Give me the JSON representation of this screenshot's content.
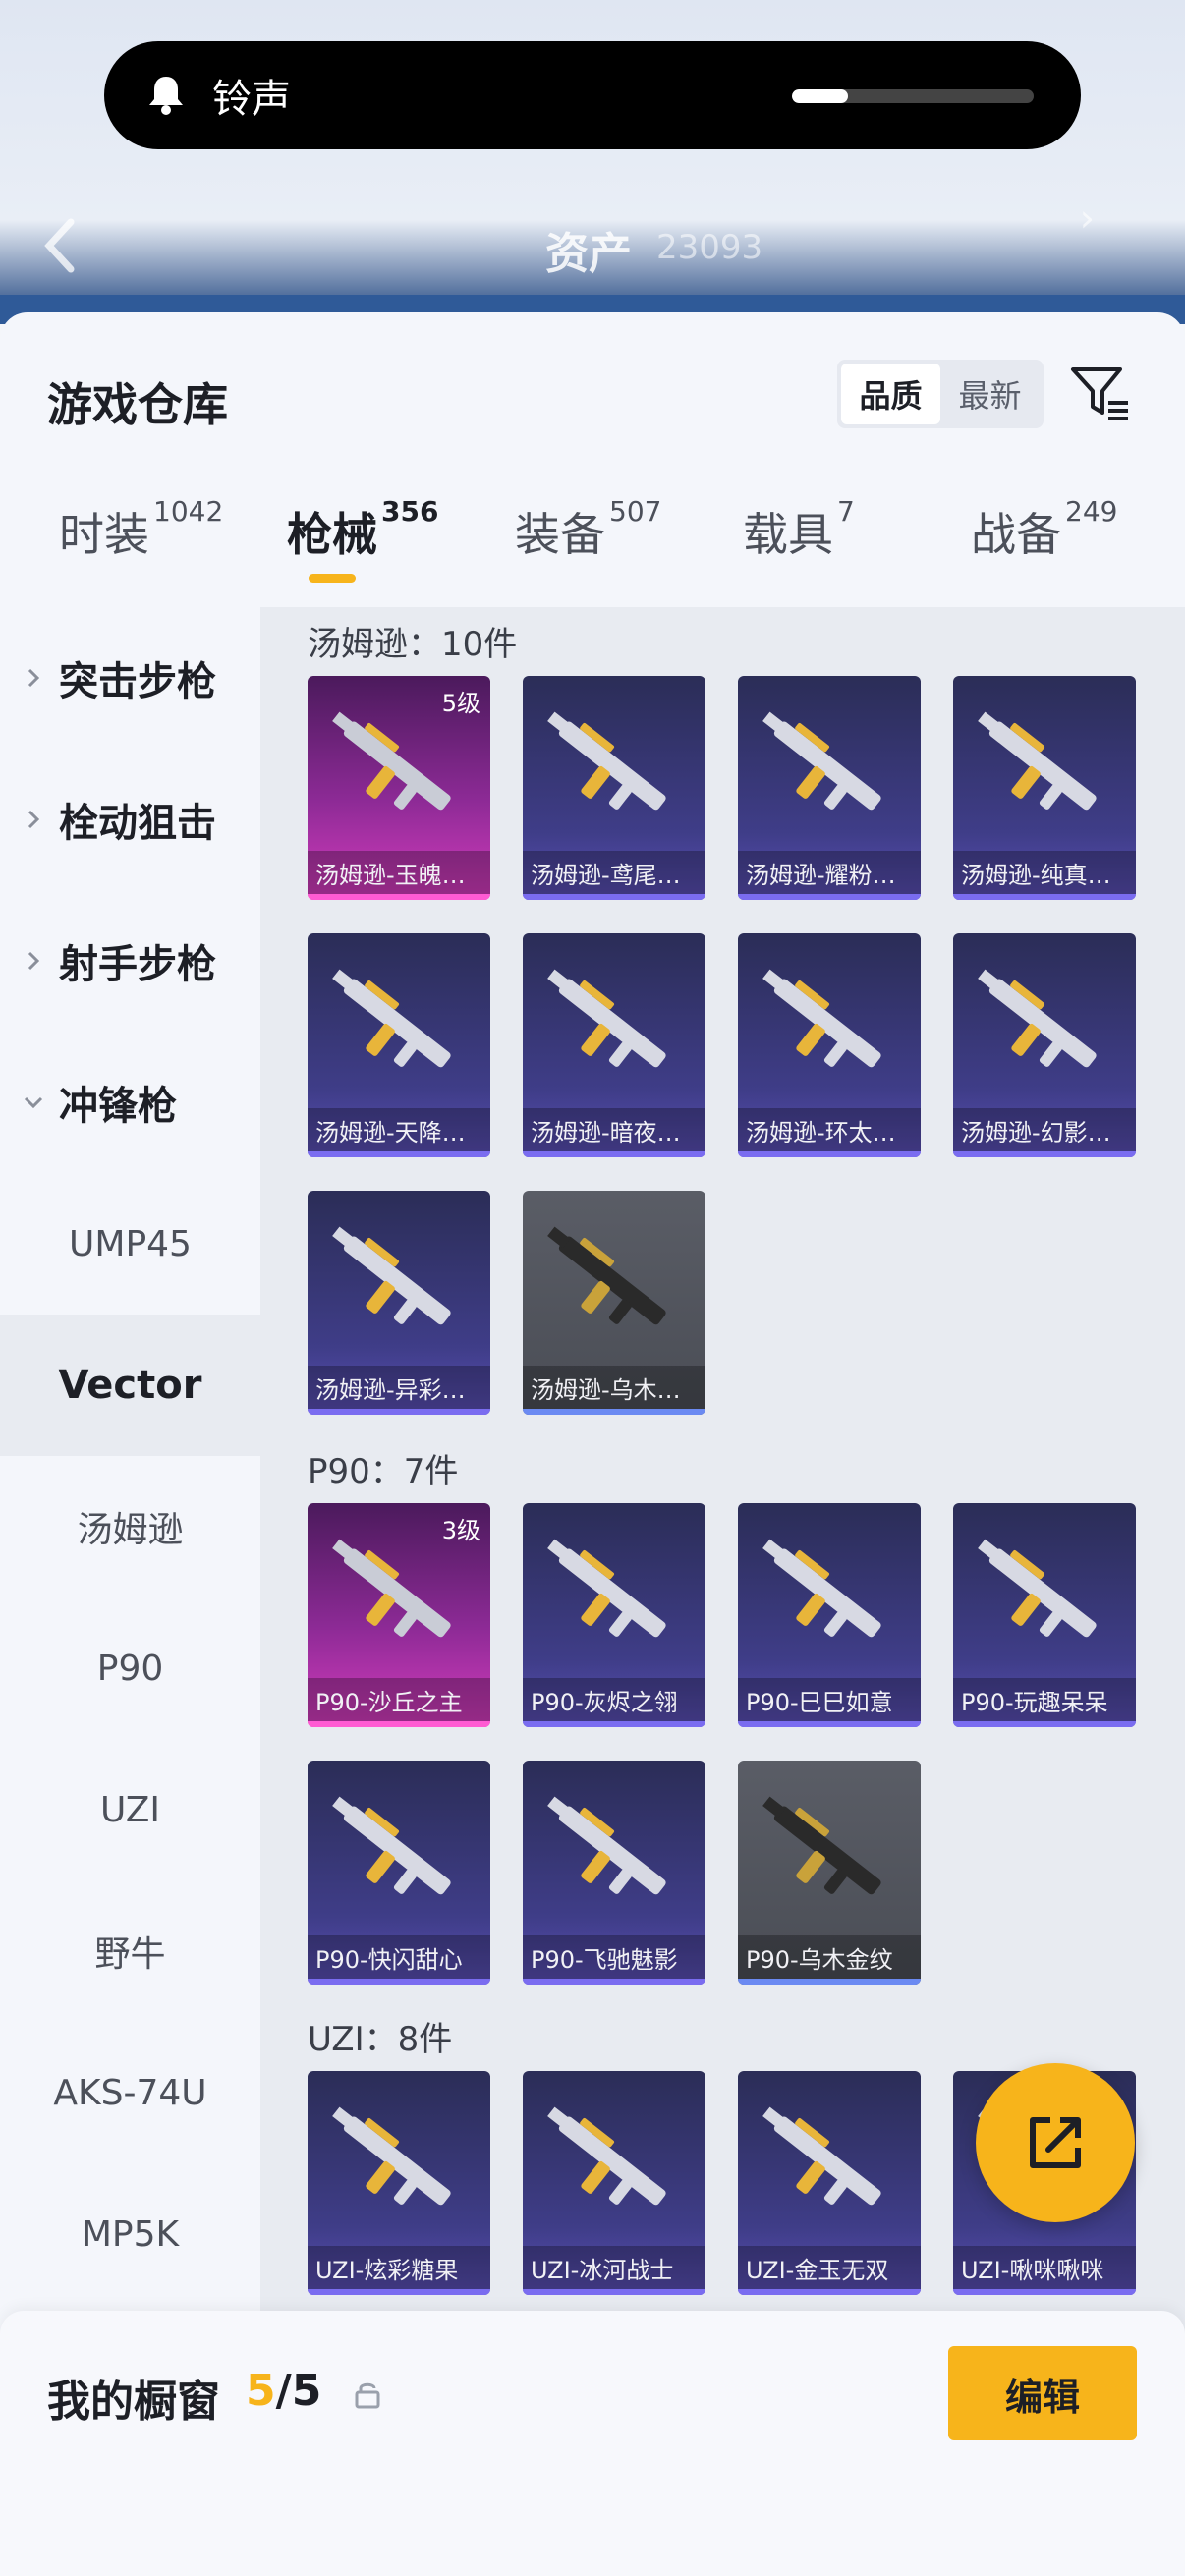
{
  "toast": {
    "label": "铃声",
    "volume": 0.23
  },
  "background_header": {
    "title": "资产",
    "balance": "23093"
  },
  "sheet": {
    "title": "游戏仓库",
    "sort": {
      "options": [
        "品质",
        "最新"
      ],
      "selected": "品质"
    }
  },
  "category_tabs": [
    {
      "label": "时装",
      "count": "1042",
      "active": false
    },
    {
      "label": "枪械",
      "count": "356",
      "active": true
    },
    {
      "label": "装备",
      "count": "507",
      "active": false
    },
    {
      "label": "载具",
      "count": "7",
      "active": false
    },
    {
      "label": "战备",
      "count": "249",
      "active": false
    }
  ],
  "side_nav": {
    "groups": [
      {
        "label": "突击步枪",
        "expanded": false
      },
      {
        "label": "栓动狙击",
        "expanded": false
      },
      {
        "label": "射手步枪",
        "expanded": false
      },
      {
        "label": "冲锋枪",
        "expanded": true
      }
    ],
    "subitems": [
      "UMP45",
      "Vector",
      "汤姆逊",
      "P90",
      "UZI",
      "野牛",
      "AKS-74U",
      "MP5K"
    ],
    "active_subitem": "Vector"
  },
  "groups": [
    {
      "title": "汤姆逊：10件",
      "items": [
        {
          "name": "汤姆逊-玉魄…",
          "rarity": "pink",
          "level": "5级"
        },
        {
          "name": "汤姆逊-鸢尾…",
          "rarity": "purple"
        },
        {
          "name": "汤姆逊-耀粉…",
          "rarity": "purple"
        },
        {
          "name": "汤姆逊-纯真…",
          "rarity": "purple"
        },
        {
          "name": "汤姆逊-天降…",
          "rarity": "purple"
        },
        {
          "name": "汤姆逊-暗夜…",
          "rarity": "purple"
        },
        {
          "name": "汤姆逊-环太…",
          "rarity": "purple"
        },
        {
          "name": "汤姆逊-幻影…",
          "rarity": "purple"
        },
        {
          "name": "汤姆逊-异彩…",
          "rarity": "purple"
        },
        {
          "name": "汤姆逊-乌木…",
          "rarity": "gray"
        }
      ]
    },
    {
      "title": "P90：7件",
      "items": [
        {
          "name": "P90-沙丘之主",
          "rarity": "pink",
          "level": "3级"
        },
        {
          "name": "P90-灰烬之翎",
          "rarity": "purple"
        },
        {
          "name": "P90-巳巳如意",
          "rarity": "purple"
        },
        {
          "name": "P90-玩趣呆呆",
          "rarity": "purple"
        },
        {
          "name": "P90-快闪甜心",
          "rarity": "purple"
        },
        {
          "name": "P90-飞驰魅影",
          "rarity": "purple"
        },
        {
          "name": "P90-乌木金纹",
          "rarity": "gray"
        }
      ]
    },
    {
      "title": "UZI：8件",
      "items": [
        {
          "name": "UZI-炫彩糖果",
          "rarity": "purple"
        },
        {
          "name": "UZI-冰河战士",
          "rarity": "purple"
        },
        {
          "name": "UZI-金玉无双",
          "rarity": "purple"
        },
        {
          "name": "UZI-啾咪啾咪",
          "rarity": "purple"
        }
      ]
    }
  ],
  "showcase": {
    "label": "我的橱窗",
    "current": "5",
    "total": "/5"
  },
  "edit_label": "编辑",
  "icons": {
    "bell": "bell-icon",
    "filter": "filter-icon",
    "share": "share-icon",
    "lock": "lock-icon",
    "chevron": "chevron-icon"
  },
  "colors": {
    "accent": "#f7b41b",
    "pink_rarity": "#d43cbd",
    "purple_rarity": "#5a4fb5"
  }
}
